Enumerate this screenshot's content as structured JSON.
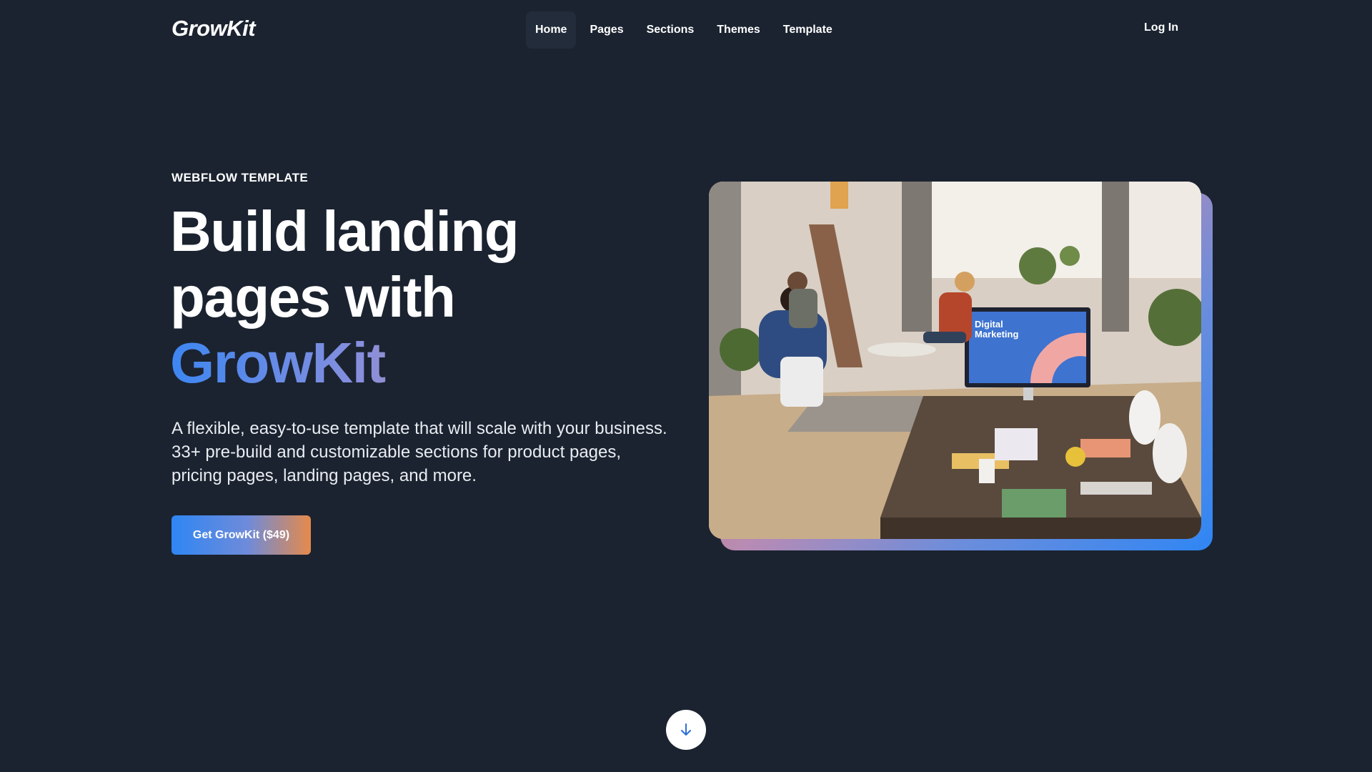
{
  "nav": {
    "logo": "GrowKit",
    "links": [
      {
        "label": "Home",
        "active": true
      },
      {
        "label": "Pages",
        "active": false
      },
      {
        "label": "Sections",
        "active": false
      },
      {
        "label": "Themes",
        "active": false
      },
      {
        "label": "Template",
        "active": false
      }
    ],
    "login": "Log In"
  },
  "hero": {
    "eyebrow": "WEBFLOW TEMPLATE",
    "headline_line1": "Build landing",
    "headline_line2": "pages with",
    "headline_brand": "GrowKit",
    "description": "A flexible, easy-to-use template that will scale with your business. 33+ pre-build and customizable sections for product pages, pricing pages, landing pages, and more.",
    "cta_label": "Get GrowKit ($49)",
    "image": {
      "screen_text_line1": "Digital",
      "screen_text_line2": "Marketing"
    }
  },
  "scroll_icon": "arrow-down-icon",
  "colors": {
    "background": "#1b2330",
    "gradient_blue": "#2f86f4",
    "gradient_purple": "#8a8fdc",
    "gradient_orange": "#e88c3f"
  }
}
